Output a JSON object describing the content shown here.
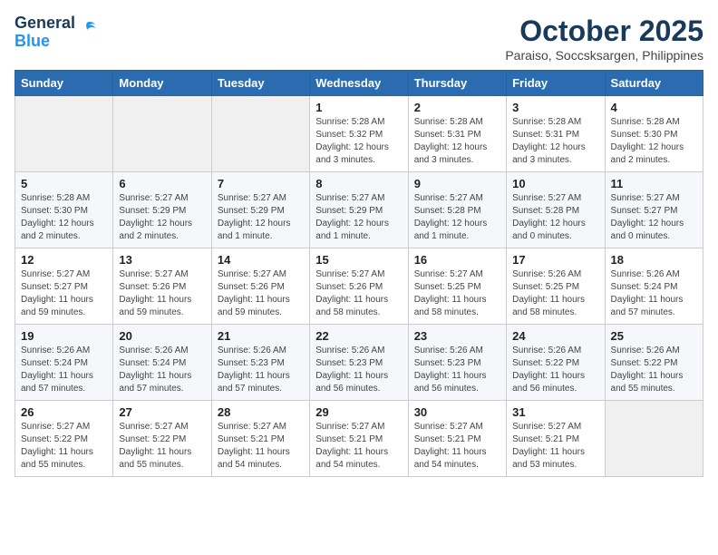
{
  "logo": {
    "general": "General",
    "blue": "Blue"
  },
  "header": {
    "month": "October 2025",
    "location": "Paraiso, Soccsksargen, Philippines"
  },
  "weekdays": [
    "Sunday",
    "Monday",
    "Tuesday",
    "Wednesday",
    "Thursday",
    "Friday",
    "Saturday"
  ],
  "weeks": [
    [
      {
        "day": "",
        "sunrise": "",
        "sunset": "",
        "daylight": ""
      },
      {
        "day": "",
        "sunrise": "",
        "sunset": "",
        "daylight": ""
      },
      {
        "day": "",
        "sunrise": "",
        "sunset": "",
        "daylight": ""
      },
      {
        "day": "1",
        "sunrise": "Sunrise: 5:28 AM",
        "sunset": "Sunset: 5:32 PM",
        "daylight": "Daylight: 12 hours and 3 minutes."
      },
      {
        "day": "2",
        "sunrise": "Sunrise: 5:28 AM",
        "sunset": "Sunset: 5:31 PM",
        "daylight": "Daylight: 12 hours and 3 minutes."
      },
      {
        "day": "3",
        "sunrise": "Sunrise: 5:28 AM",
        "sunset": "Sunset: 5:31 PM",
        "daylight": "Daylight: 12 hours and 3 minutes."
      },
      {
        "day": "4",
        "sunrise": "Sunrise: 5:28 AM",
        "sunset": "Sunset: 5:30 PM",
        "daylight": "Daylight: 12 hours and 2 minutes."
      }
    ],
    [
      {
        "day": "5",
        "sunrise": "Sunrise: 5:28 AM",
        "sunset": "Sunset: 5:30 PM",
        "daylight": "Daylight: 12 hours and 2 minutes."
      },
      {
        "day": "6",
        "sunrise": "Sunrise: 5:27 AM",
        "sunset": "Sunset: 5:29 PM",
        "daylight": "Daylight: 12 hours and 2 minutes."
      },
      {
        "day": "7",
        "sunrise": "Sunrise: 5:27 AM",
        "sunset": "Sunset: 5:29 PM",
        "daylight": "Daylight: 12 hours and 1 minute."
      },
      {
        "day": "8",
        "sunrise": "Sunrise: 5:27 AM",
        "sunset": "Sunset: 5:29 PM",
        "daylight": "Daylight: 12 hours and 1 minute."
      },
      {
        "day": "9",
        "sunrise": "Sunrise: 5:27 AM",
        "sunset": "Sunset: 5:28 PM",
        "daylight": "Daylight: 12 hours and 1 minute."
      },
      {
        "day": "10",
        "sunrise": "Sunrise: 5:27 AM",
        "sunset": "Sunset: 5:28 PM",
        "daylight": "Daylight: 12 hours and 0 minutes."
      },
      {
        "day": "11",
        "sunrise": "Sunrise: 5:27 AM",
        "sunset": "Sunset: 5:27 PM",
        "daylight": "Daylight: 12 hours and 0 minutes."
      }
    ],
    [
      {
        "day": "12",
        "sunrise": "Sunrise: 5:27 AM",
        "sunset": "Sunset: 5:27 PM",
        "daylight": "Daylight: 11 hours and 59 minutes."
      },
      {
        "day": "13",
        "sunrise": "Sunrise: 5:27 AM",
        "sunset": "Sunset: 5:26 PM",
        "daylight": "Daylight: 11 hours and 59 minutes."
      },
      {
        "day": "14",
        "sunrise": "Sunrise: 5:27 AM",
        "sunset": "Sunset: 5:26 PM",
        "daylight": "Daylight: 11 hours and 59 minutes."
      },
      {
        "day": "15",
        "sunrise": "Sunrise: 5:27 AM",
        "sunset": "Sunset: 5:26 PM",
        "daylight": "Daylight: 11 hours and 58 minutes."
      },
      {
        "day": "16",
        "sunrise": "Sunrise: 5:27 AM",
        "sunset": "Sunset: 5:25 PM",
        "daylight": "Daylight: 11 hours and 58 minutes."
      },
      {
        "day": "17",
        "sunrise": "Sunrise: 5:26 AM",
        "sunset": "Sunset: 5:25 PM",
        "daylight": "Daylight: 11 hours and 58 minutes."
      },
      {
        "day": "18",
        "sunrise": "Sunrise: 5:26 AM",
        "sunset": "Sunset: 5:24 PM",
        "daylight": "Daylight: 11 hours and 57 minutes."
      }
    ],
    [
      {
        "day": "19",
        "sunrise": "Sunrise: 5:26 AM",
        "sunset": "Sunset: 5:24 PM",
        "daylight": "Daylight: 11 hours and 57 minutes."
      },
      {
        "day": "20",
        "sunrise": "Sunrise: 5:26 AM",
        "sunset": "Sunset: 5:24 PM",
        "daylight": "Daylight: 11 hours and 57 minutes."
      },
      {
        "day": "21",
        "sunrise": "Sunrise: 5:26 AM",
        "sunset": "Sunset: 5:23 PM",
        "daylight": "Daylight: 11 hours and 57 minutes."
      },
      {
        "day": "22",
        "sunrise": "Sunrise: 5:26 AM",
        "sunset": "Sunset: 5:23 PM",
        "daylight": "Daylight: 11 hours and 56 minutes."
      },
      {
        "day": "23",
        "sunrise": "Sunrise: 5:26 AM",
        "sunset": "Sunset: 5:23 PM",
        "daylight": "Daylight: 11 hours and 56 minutes."
      },
      {
        "day": "24",
        "sunrise": "Sunrise: 5:26 AM",
        "sunset": "Sunset: 5:22 PM",
        "daylight": "Daylight: 11 hours and 56 minutes."
      },
      {
        "day": "25",
        "sunrise": "Sunrise: 5:26 AM",
        "sunset": "Sunset: 5:22 PM",
        "daylight": "Daylight: 11 hours and 55 minutes."
      }
    ],
    [
      {
        "day": "26",
        "sunrise": "Sunrise: 5:27 AM",
        "sunset": "Sunset: 5:22 PM",
        "daylight": "Daylight: 11 hours and 55 minutes."
      },
      {
        "day": "27",
        "sunrise": "Sunrise: 5:27 AM",
        "sunset": "Sunset: 5:22 PM",
        "daylight": "Daylight: 11 hours and 55 minutes."
      },
      {
        "day": "28",
        "sunrise": "Sunrise: 5:27 AM",
        "sunset": "Sunset: 5:21 PM",
        "daylight": "Daylight: 11 hours and 54 minutes."
      },
      {
        "day": "29",
        "sunrise": "Sunrise: 5:27 AM",
        "sunset": "Sunset: 5:21 PM",
        "daylight": "Daylight: 11 hours and 54 minutes."
      },
      {
        "day": "30",
        "sunrise": "Sunrise: 5:27 AM",
        "sunset": "Sunset: 5:21 PM",
        "daylight": "Daylight: 11 hours and 54 minutes."
      },
      {
        "day": "31",
        "sunrise": "Sunrise: 5:27 AM",
        "sunset": "Sunset: 5:21 PM",
        "daylight": "Daylight: 11 hours and 53 minutes."
      },
      {
        "day": "",
        "sunrise": "",
        "sunset": "",
        "daylight": ""
      }
    ]
  ]
}
